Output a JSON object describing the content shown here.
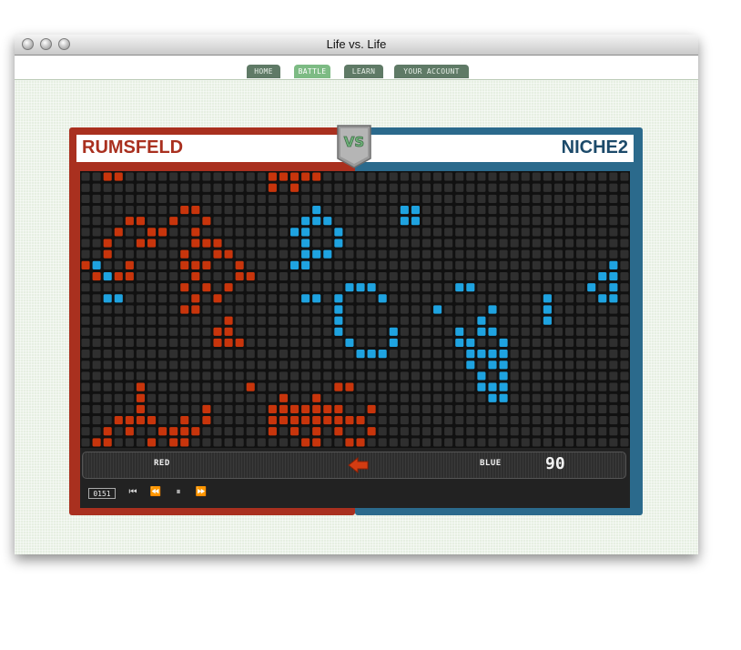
{
  "window": {
    "title": "Life vs. Life"
  },
  "nav": {
    "tabs": [
      {
        "label": "HOME",
        "active": false
      },
      {
        "label": "BATTLE",
        "active": true
      },
      {
        "label": "LEARN",
        "active": false
      },
      {
        "label": "YOUR ACCOUNT",
        "active": false
      }
    ]
  },
  "battle": {
    "red_player": "RUMSFELD",
    "blue_player": "NICHE2",
    "vs_label": "VS",
    "red_label": "RED",
    "blue_label": "BLUE",
    "blue_score": "90",
    "generation": "0151",
    "advantage_arrow": "left-arrow-icon",
    "colors": {
      "red": "#c8350c",
      "blue": "#1fa3e0",
      "empty": "#2f2f2f",
      "board_bg": "#111111"
    }
  },
  "board": {
    "cols": 50,
    "rows": 25,
    "red_cells": [
      [
        2,
        0
      ],
      [
        3,
        0
      ],
      [
        17,
        0
      ],
      [
        18,
        0
      ],
      [
        19,
        0
      ],
      [
        20,
        0
      ],
      [
        21,
        0
      ],
      [
        17,
        1
      ],
      [
        19,
        1
      ],
      [
        9,
        3
      ],
      [
        10,
        3
      ],
      [
        4,
        4
      ],
      [
        5,
        4
      ],
      [
        8,
        4
      ],
      [
        11,
        4
      ],
      [
        3,
        5
      ],
      [
        6,
        5
      ],
      [
        7,
        5
      ],
      [
        10,
        5
      ],
      [
        2,
        6
      ],
      [
        5,
        6
      ],
      [
        6,
        6
      ],
      [
        10,
        6
      ],
      [
        11,
        6
      ],
      [
        12,
        6
      ],
      [
        2,
        7
      ],
      [
        5,
        6
      ],
      [
        9,
        7
      ],
      [
        12,
        7
      ],
      [
        13,
        7
      ],
      [
        0,
        8
      ],
      [
        4,
        8
      ],
      [
        9,
        8
      ],
      [
        10,
        8
      ],
      [
        11,
        8
      ],
      [
        14,
        8
      ],
      [
        1,
        9
      ],
      [
        3,
        9
      ],
      [
        4,
        9
      ],
      [
        10,
        9
      ],
      [
        14,
        9
      ],
      [
        15,
        9
      ],
      [
        9,
        10
      ],
      [
        11,
        10
      ],
      [
        13,
        10
      ],
      [
        10,
        11
      ],
      [
        12,
        11
      ],
      [
        9,
        12
      ],
      [
        10,
        12
      ],
      [
        13,
        13
      ],
      [
        12,
        14
      ],
      [
        13,
        14
      ],
      [
        14,
        15
      ],
      [
        13,
        15
      ],
      [
        12,
        15
      ],
      [
        5,
        19
      ],
      [
        5,
        20
      ],
      [
        5,
        21
      ],
      [
        18,
        20
      ],
      [
        21,
        20
      ],
      [
        15,
        19
      ],
      [
        23,
        19
      ],
      [
        24,
        19
      ],
      [
        17,
        21
      ],
      [
        18,
        21
      ],
      [
        19,
        21
      ],
      [
        20,
        21
      ],
      [
        21,
        21
      ],
      [
        22,
        21
      ],
      [
        23,
        21
      ],
      [
        17,
        22
      ],
      [
        18,
        22
      ],
      [
        19,
        22
      ],
      [
        20,
        22
      ],
      [
        21,
        22
      ],
      [
        22,
        22
      ],
      [
        23,
        22
      ],
      [
        24,
        22
      ],
      [
        25,
        22
      ],
      [
        26,
        21
      ],
      [
        11,
        21
      ],
      [
        3,
        22
      ],
      [
        4,
        22
      ],
      [
        5,
        22
      ],
      [
        6,
        22
      ],
      [
        9,
        22
      ],
      [
        11,
        22
      ],
      [
        2,
        23
      ],
      [
        4,
        23
      ],
      [
        9,
        23
      ],
      [
        10,
        23
      ],
      [
        17,
        23
      ],
      [
        19,
        23
      ],
      [
        21,
        23
      ],
      [
        23,
        23
      ],
      [
        26,
        23
      ],
      [
        1,
        24
      ],
      [
        2,
        24
      ],
      [
        6,
        24
      ],
      [
        8,
        24
      ],
      [
        9,
        24
      ],
      [
        20,
        24
      ],
      [
        21,
        24
      ],
      [
        24,
        24
      ],
      [
        25,
        24
      ],
      [
        7,
        23
      ],
      [
        8,
        23
      ]
    ],
    "blue_cells": [
      [
        21,
        3
      ],
      [
        29,
        3
      ],
      [
        30,
        3
      ],
      [
        20,
        4
      ],
      [
        29,
        4
      ],
      [
        30,
        4
      ],
      [
        21,
        4
      ],
      [
        22,
        4
      ],
      [
        19,
        5
      ],
      [
        20,
        5
      ],
      [
        23,
        5
      ],
      [
        20,
        6
      ],
      [
        23,
        6
      ],
      [
        20,
        7
      ],
      [
        21,
        7
      ],
      [
        22,
        7
      ],
      [
        0,
        8
      ],
      [
        1,
        8
      ],
      [
        20,
        8
      ],
      [
        19,
        8
      ],
      [
        48,
        8
      ],
      [
        2,
        9
      ],
      [
        47,
        9
      ],
      [
        48,
        9
      ],
      [
        24,
        10
      ],
      [
        25,
        10
      ],
      [
        26,
        10
      ],
      [
        34,
        10
      ],
      [
        35,
        10
      ],
      [
        46,
        10
      ],
      [
        48,
        10
      ],
      [
        2,
        11
      ],
      [
        3,
        11
      ],
      [
        20,
        11
      ],
      [
        21,
        11
      ],
      [
        23,
        11
      ],
      [
        27,
        11
      ],
      [
        42,
        11
      ],
      [
        47,
        11
      ],
      [
        48,
        11
      ],
      [
        23,
        12
      ],
      [
        32,
        12
      ],
      [
        37,
        12
      ],
      [
        42,
        12
      ],
      [
        23,
        13
      ],
      [
        36,
        13
      ],
      [
        42,
        13
      ],
      [
        23,
        14
      ],
      [
        28,
        14
      ],
      [
        34,
        14
      ],
      [
        36,
        14
      ],
      [
        37,
        14
      ],
      [
        24,
        15
      ],
      [
        28,
        15
      ],
      [
        34,
        15
      ],
      [
        35,
        15
      ],
      [
        38,
        15
      ],
      [
        25,
        16
      ],
      [
        26,
        16
      ],
      [
        27,
        16
      ],
      [
        35,
        16
      ],
      [
        36,
        16
      ],
      [
        37,
        16
      ],
      [
        38,
        16
      ],
      [
        35,
        17
      ],
      [
        37,
        17
      ],
      [
        38,
        17
      ],
      [
        36,
        18
      ],
      [
        38,
        18
      ],
      [
        36,
        19
      ],
      [
        37,
        19
      ],
      [
        38,
        19
      ],
      [
        37,
        20
      ],
      [
        38,
        20
      ]
    ]
  }
}
